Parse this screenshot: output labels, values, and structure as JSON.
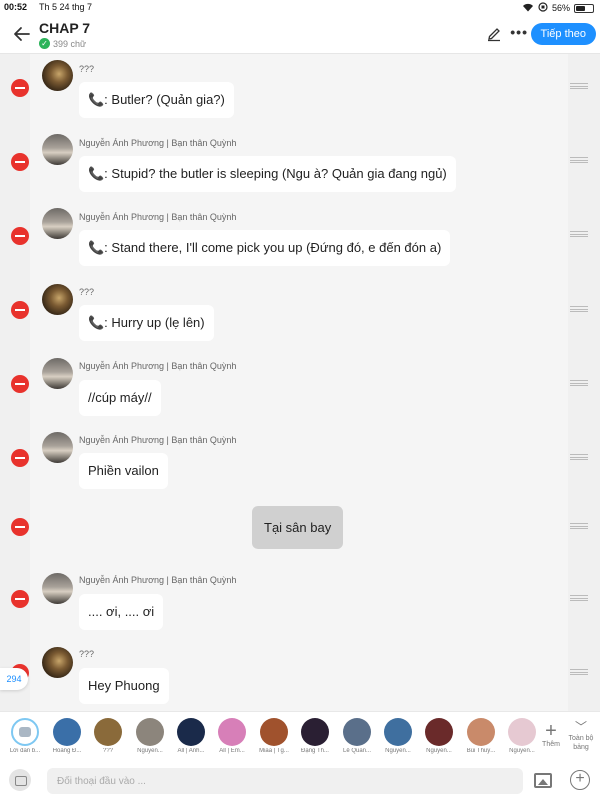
{
  "status_bar": {
    "time": "00:52",
    "date": "Th 5 24 thg 7",
    "battery": "56%",
    "battery_level": 0.56
  },
  "header": {
    "title": "CHAP 7",
    "word_count": "399 chữ",
    "next_button": "Tiếp theo"
  },
  "messages": [
    {
      "speaker": "???",
      "text": "📞: Butler? (Quản gia?)"
    },
    {
      "speaker": "Nguyễn Ánh Phương | Bạn thân Quỳnh",
      "text": "📞: Stupid? the butler is sleeping (Ngu à? Quản gia đang ngủ)"
    },
    {
      "speaker": "Nguyễn Ánh Phương | Bạn thân Quỳnh",
      "text": "📞: Stand there, I'll come pick you up (Đứng đó, e đến đón a)"
    },
    {
      "speaker": "???",
      "text": "📞: Hurry up (lẹ lên)"
    },
    {
      "speaker": "Nguyễn Ánh Phương | Bạn thân Quỳnh",
      "text": "//cúp máy//"
    },
    {
      "speaker": "Nguyễn Ánh Phương | Bạn thân Quỳnh",
      "text": "Phiền vailon"
    },
    {
      "speaker": "",
      "text": "Tại sân bay"
    },
    {
      "speaker": "Nguyễn Ánh Phương | Bạn thân Quỳnh",
      "text": ".... ơi, .... ơi"
    },
    {
      "speaker": "???",
      "text": "Hey Phuong"
    }
  ],
  "message_count": "294",
  "characters": [
    {
      "name": "Lời dẫn b...",
      "color": "#ffffff"
    },
    {
      "name": "Hoàng Đ...",
      "color": "#3a6fa8"
    },
    {
      "name": "???",
      "color": "#8a6a3a"
    },
    {
      "name": "Nguyễn...",
      "color": "#8c857c"
    },
    {
      "name": "All | Anh...",
      "color": "#1a2a4a"
    },
    {
      "name": "All | Em...",
      "color": "#d77fb8"
    },
    {
      "name": "Miaa | Tg...",
      "color": "#a0522d"
    },
    {
      "name": "Đặng Th...",
      "color": "#2a1f33"
    },
    {
      "name": "Lê Quan...",
      "color": "#5a6f8a"
    },
    {
      "name": "Nguyễn...",
      "color": "#3f6f9f"
    },
    {
      "name": "Nguyễn...",
      "color": "#6a2a2a"
    },
    {
      "name": "Bùi Thuỳ...",
      "color": "#c98a6a"
    },
    {
      "name": "Nguyễn...",
      "color": "#e6c9d2"
    }
  ],
  "add_label": "Thêm",
  "fullscreen_label": "Toàn bộ bảng",
  "input": {
    "placeholder": "Đối thoại đầu vào ..."
  }
}
